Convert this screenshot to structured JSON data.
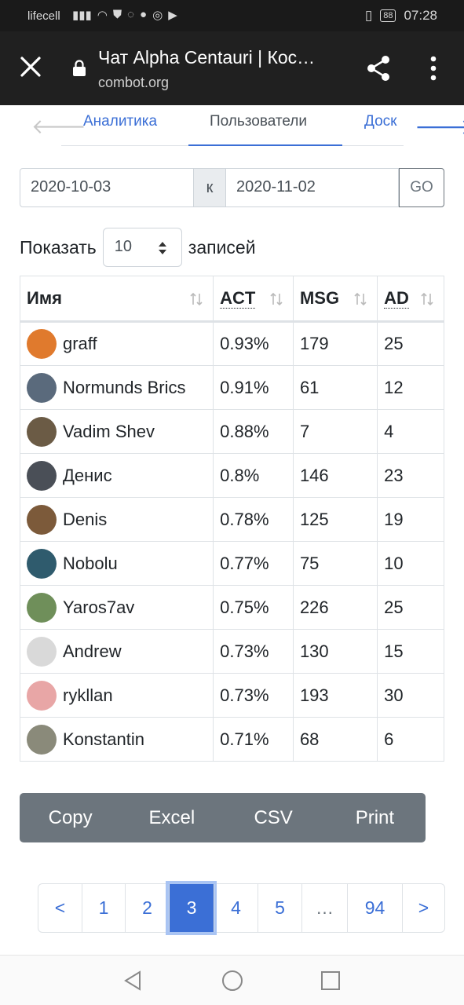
{
  "status_bar": {
    "carrier": "lifecell",
    "battery": "88",
    "time": "07:28"
  },
  "browser": {
    "title": "Чат Alpha Centauri | Кос…",
    "url": "combot.org"
  },
  "tabs": [
    {
      "label": "Аналитика",
      "active": false
    },
    {
      "label": "Пользователи",
      "active": true
    },
    {
      "label": "Доск",
      "active": false
    }
  ],
  "date_range": {
    "from": "2020-10-03",
    "separator": "к",
    "to": "2020-11-02",
    "go_label": "GO"
  },
  "length": {
    "prefix": "Показать",
    "value": "10",
    "suffix": "записей"
  },
  "table": {
    "headers": [
      "Имя",
      "ACT",
      "MSG",
      "AD"
    ],
    "rows": [
      {
        "name": "graff",
        "act": "0.93%",
        "msg": "179",
        "ad": "25",
        "avatar_color": "#e07a2d"
      },
      {
        "name": "Normunds Brics",
        "act": "0.91%",
        "msg": "61",
        "ad": "12",
        "avatar_color": "#5a6a7c"
      },
      {
        "name": "Vadim Shev",
        "act": "0.88%",
        "msg": "7",
        "ad": "4",
        "avatar_color": "#6b5b45"
      },
      {
        "name": "Денис",
        "act": "0.8%",
        "msg": "146",
        "ad": "23",
        "avatar_color": "#4a4f57"
      },
      {
        "name": "Denis",
        "act": "0.78%",
        "msg": "125",
        "ad": "19",
        "avatar_color": "#7c5a3a"
      },
      {
        "name": "Nobolu",
        "act": "0.77%",
        "msg": "75",
        "ad": "10",
        "avatar_color": "#2f5b6d"
      },
      {
        "name": "Yaros7av",
        "act": "0.75%",
        "msg": "226",
        "ad": "25",
        "avatar_color": "#6f8f5a"
      },
      {
        "name": "Andrew",
        "act": "0.73%",
        "msg": "130",
        "ad": "15",
        "avatar_color": "#d9d9d9"
      },
      {
        "name": "rykllan",
        "act": "0.73%",
        "msg": "193",
        "ad": "30",
        "avatar_color": "#e8a6a6"
      },
      {
        "name": "Konstantin",
        "act": "0.71%",
        "msg": "68",
        "ad": "6",
        "avatar_color": "#8a8a7a"
      }
    ]
  },
  "export_buttons": [
    "Copy",
    "Excel",
    "CSV",
    "Print"
  ],
  "pagination": [
    "<",
    "1",
    "2",
    "3",
    "4",
    "5",
    "…",
    "94",
    ">"
  ],
  "pagination_active": "3",
  "colors": {
    "accent": "#3b6fd6",
    "export_bg": "#6c757d",
    "toolbar_bg": "#202020"
  }
}
